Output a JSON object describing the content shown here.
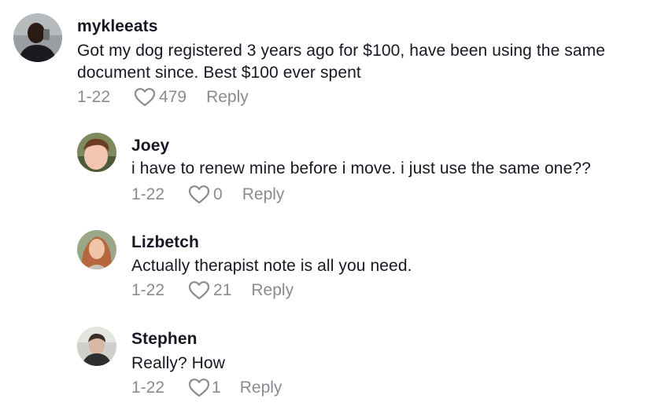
{
  "comments": [
    {
      "username": "mykleeats",
      "text": "Got my dog registered 3 years ago for $100, have been using the same document since. Best $100 ever spent",
      "date": "1-22",
      "likes": "479",
      "reply_label": "Reply"
    },
    {
      "username": "Joey",
      "text": "i have to renew mine before i move. i just use the same one??",
      "date": "1-22",
      "likes": "0",
      "reply_label": "Reply"
    },
    {
      "username": "Lizbetch",
      "text": "Actually therapist note is all you need.",
      "date": "1-22",
      "likes": "21",
      "reply_label": "Reply"
    },
    {
      "username": "Stephen",
      "text": "Really? How",
      "date": "1-22",
      "likes": "1",
      "reply_label": "Reply"
    }
  ],
  "icons": {
    "like": "heart-outline-icon"
  },
  "colors": {
    "text": "#161823",
    "meta": "#8a8b91"
  }
}
